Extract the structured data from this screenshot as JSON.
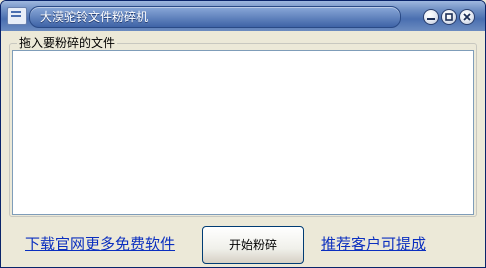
{
  "window": {
    "title": "大漠驼铃文件粉碎机",
    "controls": {
      "minimize": "minimize-icon",
      "restore": "restore-icon",
      "close": "close-icon"
    }
  },
  "main": {
    "group_label": "拖入要粉碎的文件",
    "file_list": []
  },
  "footer": {
    "left_link": "下载官网更多免费软件",
    "start_button": "开始粉碎",
    "right_link": "推荐客户可提成"
  }
}
